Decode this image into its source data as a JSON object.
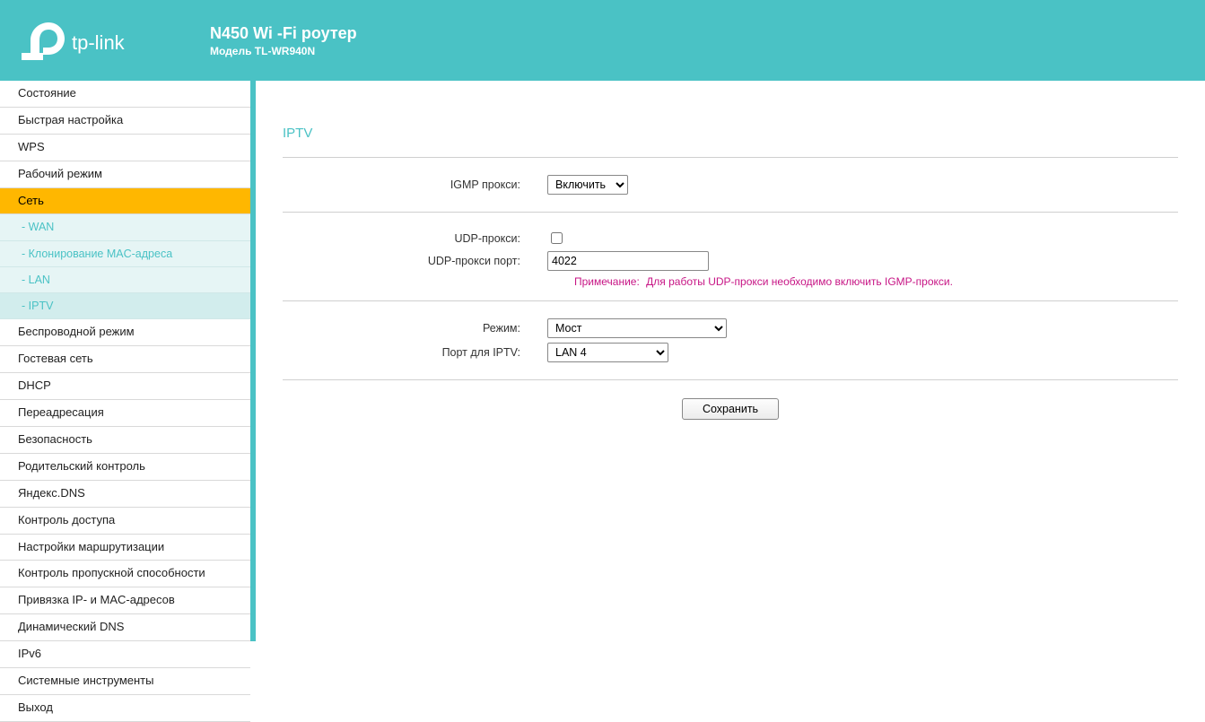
{
  "header": {
    "brand": "tp-link",
    "title": "N450 Wi -Fi роутер",
    "subtitle": "Модель TL-WR940N"
  },
  "sidebar": {
    "items": [
      {
        "label": "Состояние",
        "type": "item"
      },
      {
        "label": "Быстрая настройка",
        "type": "item"
      },
      {
        "label": "WPS",
        "type": "item"
      },
      {
        "label": "Рабочий режим",
        "type": "item"
      },
      {
        "label": "Сеть",
        "type": "active"
      },
      {
        "label": "- WAN",
        "type": "sub"
      },
      {
        "label": "- Клонирование MAC-адреса",
        "type": "sub"
      },
      {
        "label": "- LAN",
        "type": "sub"
      },
      {
        "label": "- IPTV",
        "type": "sub selected"
      },
      {
        "label": "Беспроводной режим",
        "type": "item"
      },
      {
        "label": "Гостевая сеть",
        "type": "item"
      },
      {
        "label": "DHCP",
        "type": "item"
      },
      {
        "label": "Переадресация",
        "type": "item"
      },
      {
        "label": "Безопасность",
        "type": "item"
      },
      {
        "label": "Родительский контроль",
        "type": "item"
      },
      {
        "label": "Яндекс.DNS",
        "type": "item"
      },
      {
        "label": "Контроль доступа",
        "type": "item"
      },
      {
        "label": "Настройки маршрутизации",
        "type": "item"
      },
      {
        "label": "Контроль пропускной способности",
        "type": "item"
      },
      {
        "label": "Привязка IP- и MAC-адресов",
        "type": "item"
      },
      {
        "label": "Динамический DNS",
        "type": "item"
      },
      {
        "label": "IPv6",
        "type": "item"
      },
      {
        "label": "Системные инструменты",
        "type": "item"
      },
      {
        "label": "Выход",
        "type": "item"
      }
    ]
  },
  "page": {
    "title": "IPTV",
    "igmp_label": "IGMP прокси:",
    "igmp_value": "Включить",
    "udp_proxy_label": "UDP-прокси:",
    "udp_proxy_checked": false,
    "udp_port_label": "UDP-прокси порт:",
    "udp_port_value": "4022",
    "note_label": "Примечание:",
    "note_text": "Для работы UDP-прокси необходимо включить IGMP-прокси.",
    "mode_label": "Режим:",
    "mode_value": "Мост",
    "port_iptv_label": "Порт для IPTV:",
    "port_iptv_value": "LAN 4",
    "save_label": "Сохранить"
  }
}
